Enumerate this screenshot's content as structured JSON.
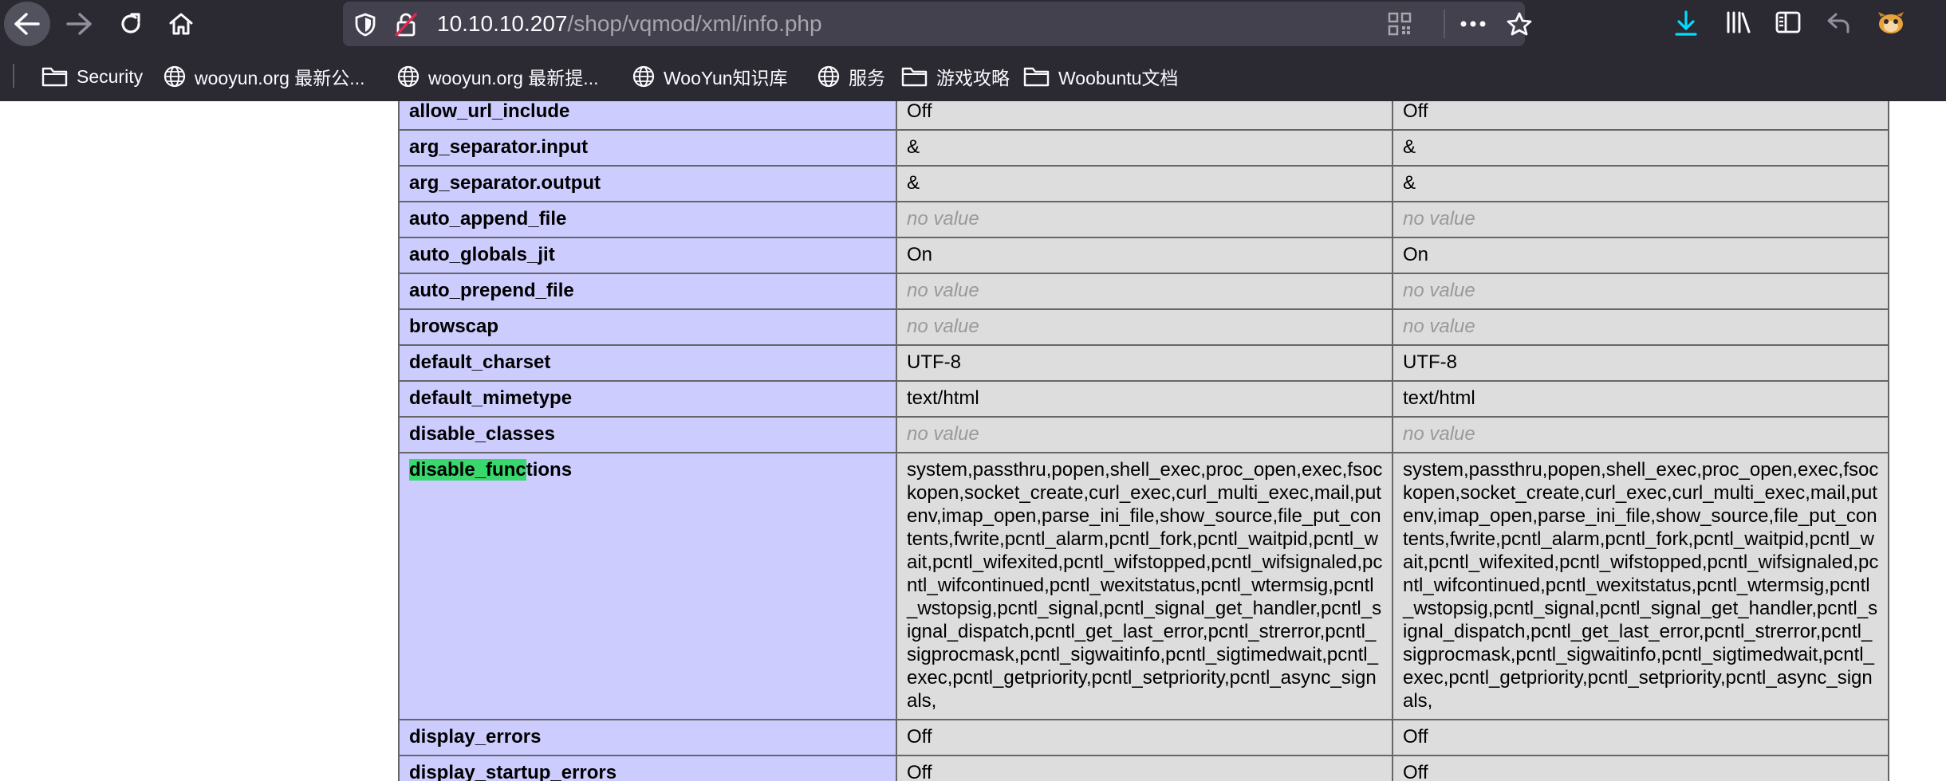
{
  "browser": {
    "url_host": "10.10.10.207",
    "url_path": "/shop/vqmod/xml/info.php",
    "toolbar_icons": [
      "back-arrow-icon",
      "forward-arrow-icon",
      "reload-icon",
      "home-icon",
      "shield-icon",
      "insecure-lock-icon",
      "qr-code-icon",
      "more-icon",
      "star-icon",
      "download-icon",
      "library-icon",
      "sidebar-icon",
      "undo-icon",
      "extension-icon"
    ],
    "bookmarks": [
      {
        "label": "Security",
        "icon": "folder-icon"
      },
      {
        "label": "wooyun.org 最新公...",
        "icon": "globe-icon"
      },
      {
        "label": "wooyun.org 最新提...",
        "icon": "globe-icon"
      },
      {
        "label": "WooYun知识库",
        "icon": "globe-icon"
      },
      {
        "label": "服务",
        "icon": "globe-icon"
      },
      {
        "label": "游戏攻略",
        "icon": "folder-icon"
      },
      {
        "label": "Woobuntu文档",
        "icon": "folder-icon"
      }
    ]
  },
  "phpinfo": {
    "search_highlight": "disable_func",
    "rows": [
      {
        "directive": "allow_url_include",
        "local": "Off",
        "master": "Off"
      },
      {
        "directive": "arg_separator.input",
        "local": "&",
        "master": "&"
      },
      {
        "directive": "arg_separator.output",
        "local": "&",
        "master": "&"
      },
      {
        "directive": "auto_append_file",
        "local": "no value",
        "master": "no value"
      },
      {
        "directive": "auto_globals_jit",
        "local": "On",
        "master": "On"
      },
      {
        "directive": "auto_prepend_file",
        "local": "no value",
        "master": "no value"
      },
      {
        "directive": "browscap",
        "local": "no value",
        "master": "no value"
      },
      {
        "directive": "default_charset",
        "local": "UTF-8",
        "master": "UTF-8"
      },
      {
        "directive": "default_mimetype",
        "local": "text/html",
        "master": "text/html"
      },
      {
        "directive": "disable_classes",
        "local": "no value",
        "master": "no value"
      },
      {
        "directive_highlighted": "disable_func",
        "directive_rest": "tions",
        "local": "system,passthru,popen,shell_exec,proc_open,exec,fsockopen,socket_create,curl_exec,curl_multi_exec,mail,putenv,imap_open,parse_ini_file,show_source,file_put_contents,fwrite,pcntl_alarm,pcntl_fork,pcntl_waitpid,pcntl_wait,pcntl_wifexited,pcntl_wifstopped,pcntl_wifsignaled,pcntl_wifcontinued,pcntl_wexitstatus,pcntl_wtermsig,pcntl_wstopsig,pcntl_signal,pcntl_signal_get_handler,pcntl_signal_dispatch,pcntl_get_last_error,pcntl_strerror,pcntl_sigprocmask,pcntl_sigwaitinfo,pcntl_sigtimedwait,pcntl_exec,pcntl_getpriority,pcntl_setpriority,pcntl_async_signals,",
        "master": "system,passthru,popen,shell_exec,proc_open,exec,fsockopen,socket_create,curl_exec,curl_multi_exec,mail,putenv,imap_open,parse_ini_file,show_source,file_put_contents,fwrite,pcntl_alarm,pcntl_fork,pcntl_waitpid,pcntl_wait,pcntl_wifexited,pcntl_wifstopped,pcntl_wifsignaled,pcntl_wifcontinued,pcntl_wexitstatus,pcntl_wtermsig,pcntl_wstopsig,pcntl_signal,pcntl_signal_get_handler,pcntl_signal_dispatch,pcntl_get_last_error,pcntl_strerror,pcntl_sigprocmask,pcntl_sigwaitinfo,pcntl_sigtimedwait,pcntl_exec,pcntl_getpriority,pcntl_setpriority,pcntl_async_signals,"
      },
      {
        "directive": "display_errors",
        "local": "Off",
        "master": "Off"
      },
      {
        "directive": "display_startup_errors",
        "local": "Off",
        "master": "Off"
      }
    ]
  },
  "colors": {
    "chrome_bg": "#2b2a33",
    "urlbar_bg": "#42414d",
    "directive_bg": "#ccccff",
    "value_bg": "#dddddd",
    "no_value_text": "#999999",
    "highlight": "#38d86c",
    "download_blue": "#00ddff"
  }
}
